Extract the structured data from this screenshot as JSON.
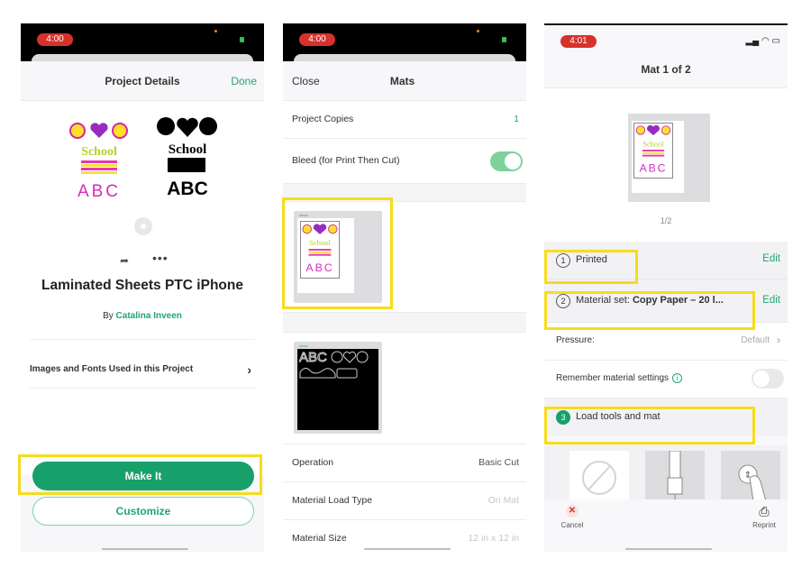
{
  "screens": [
    {
      "status": {
        "time": "4:00"
      },
      "nav": {
        "title": "Project Details",
        "done": "Done"
      },
      "project": {
        "title": "Laminated Sheets PTC iPhone",
        "by_prefix": "By",
        "author": "Catalina Inveen",
        "art_print": {
          "word": "School",
          "letters": "ABC"
        },
        "art_cut": {
          "word": "School",
          "letters": "ABC"
        }
      },
      "images_fonts_label": "Images and Fonts Used in this Project",
      "buttons": {
        "make_it": "Make It",
        "customize": "Customize"
      }
    },
    {
      "status": {
        "time": "4:00"
      },
      "nav": {
        "close": "Close",
        "title": "Mats"
      },
      "rows": {
        "copies_label": "Project Copies",
        "copies_value": "1",
        "bleed_label": "Bleed (for Print Then Cut)",
        "bleed_on": true
      },
      "mat_brand": "cricut",
      "details": [
        {
          "label": "Operation",
          "value": "Basic Cut"
        },
        {
          "label": "Material Load Type",
          "value": "On Mat"
        },
        {
          "label": "Material Size",
          "value": "12 in x 12 in"
        }
      ]
    },
    {
      "status": {
        "time": "4:01"
      },
      "nav": {
        "title": "Mat 1 of 2"
      },
      "pager": "1/2",
      "steps": [
        {
          "num": "1",
          "label": "Printed",
          "action": "Edit"
        },
        {
          "num": "2",
          "label_prefix": "Material set:",
          "label_value": "Copy Paper – 20 l...",
          "action": "Edit"
        },
        {
          "num": "3",
          "label": "Load tools and mat"
        }
      ],
      "pressure": {
        "label": "Pressure:",
        "value": "Default"
      },
      "remember": {
        "label": "Remember material settings",
        "on": false
      },
      "bottom": {
        "cancel": "Cancel",
        "reprint": "Reprint"
      }
    }
  ],
  "colors": {
    "accent": "#17a06a",
    "highlight": "#f6dc1c",
    "time_pill": "#d6322b"
  }
}
